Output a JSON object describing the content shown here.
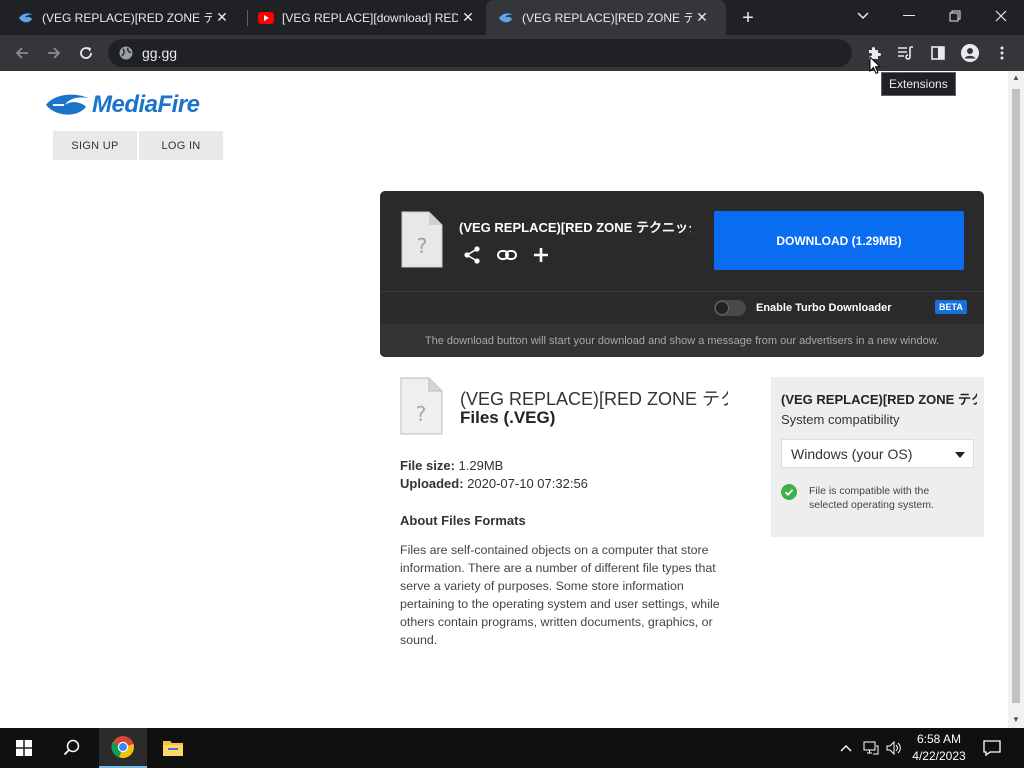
{
  "tabs": [
    {
      "title": "(VEG REPLACE)[RED ZONE テクニック",
      "favicon": "mediafire-icon",
      "active": false
    },
    {
      "title": "[VEG REPLACE][download] RED ZONE",
      "favicon": "youtube-icon",
      "active": false
    },
    {
      "title": "(VEG REPLACE)[RED ZONE テクニック",
      "favicon": "mediafire-icon",
      "active": true
    }
  ],
  "browser": {
    "url": "gg.gg",
    "tooltip": "Extensions"
  },
  "mediafire": {
    "logo_text": "MediaFire",
    "sign_up": "SIGN UP",
    "log_in": "LOG IN",
    "file_name": "(VEG REPLACE)[RED ZONE テクニック",
    "download_label": "DOWNLOAD (1.29MB)",
    "turbo_label": "Enable Turbo Downloader",
    "turbo_enabled": false,
    "beta_badge": "BETA",
    "notice": "The download button will start your download and show a message from our advertisers in a new window.",
    "file_title": "(VEG REPLACE)[RED ZONE テクニック",
    "file_type": "Files (.VEG)",
    "file_size_label": "File size:",
    "file_size": "1.29MB",
    "uploaded_label": "Uploaded:",
    "uploaded": "2020-07-10 07:32:56",
    "about_heading": "About Files Formats",
    "about_text": "Files are self-contained objects on a computer that store information. There are a number of different file types that serve a variety of purposes. Some store information pertaining to the operating system and user settings, while others contain programs, written documents, graphics, or sound."
  },
  "compat": {
    "title": "(VEG REPLACE)[RED ZONE テクニック",
    "label": "System compatibility",
    "selected_os": "Windows (your OS)",
    "status": "File is compatible with the selected operating system."
  },
  "taskbar": {
    "time": "6:58 AM",
    "date": "4/22/2023"
  },
  "colors": {
    "download_button": "#0a6cf0",
    "brand": "#1b74c9",
    "compatible_check": "#3db24a"
  }
}
